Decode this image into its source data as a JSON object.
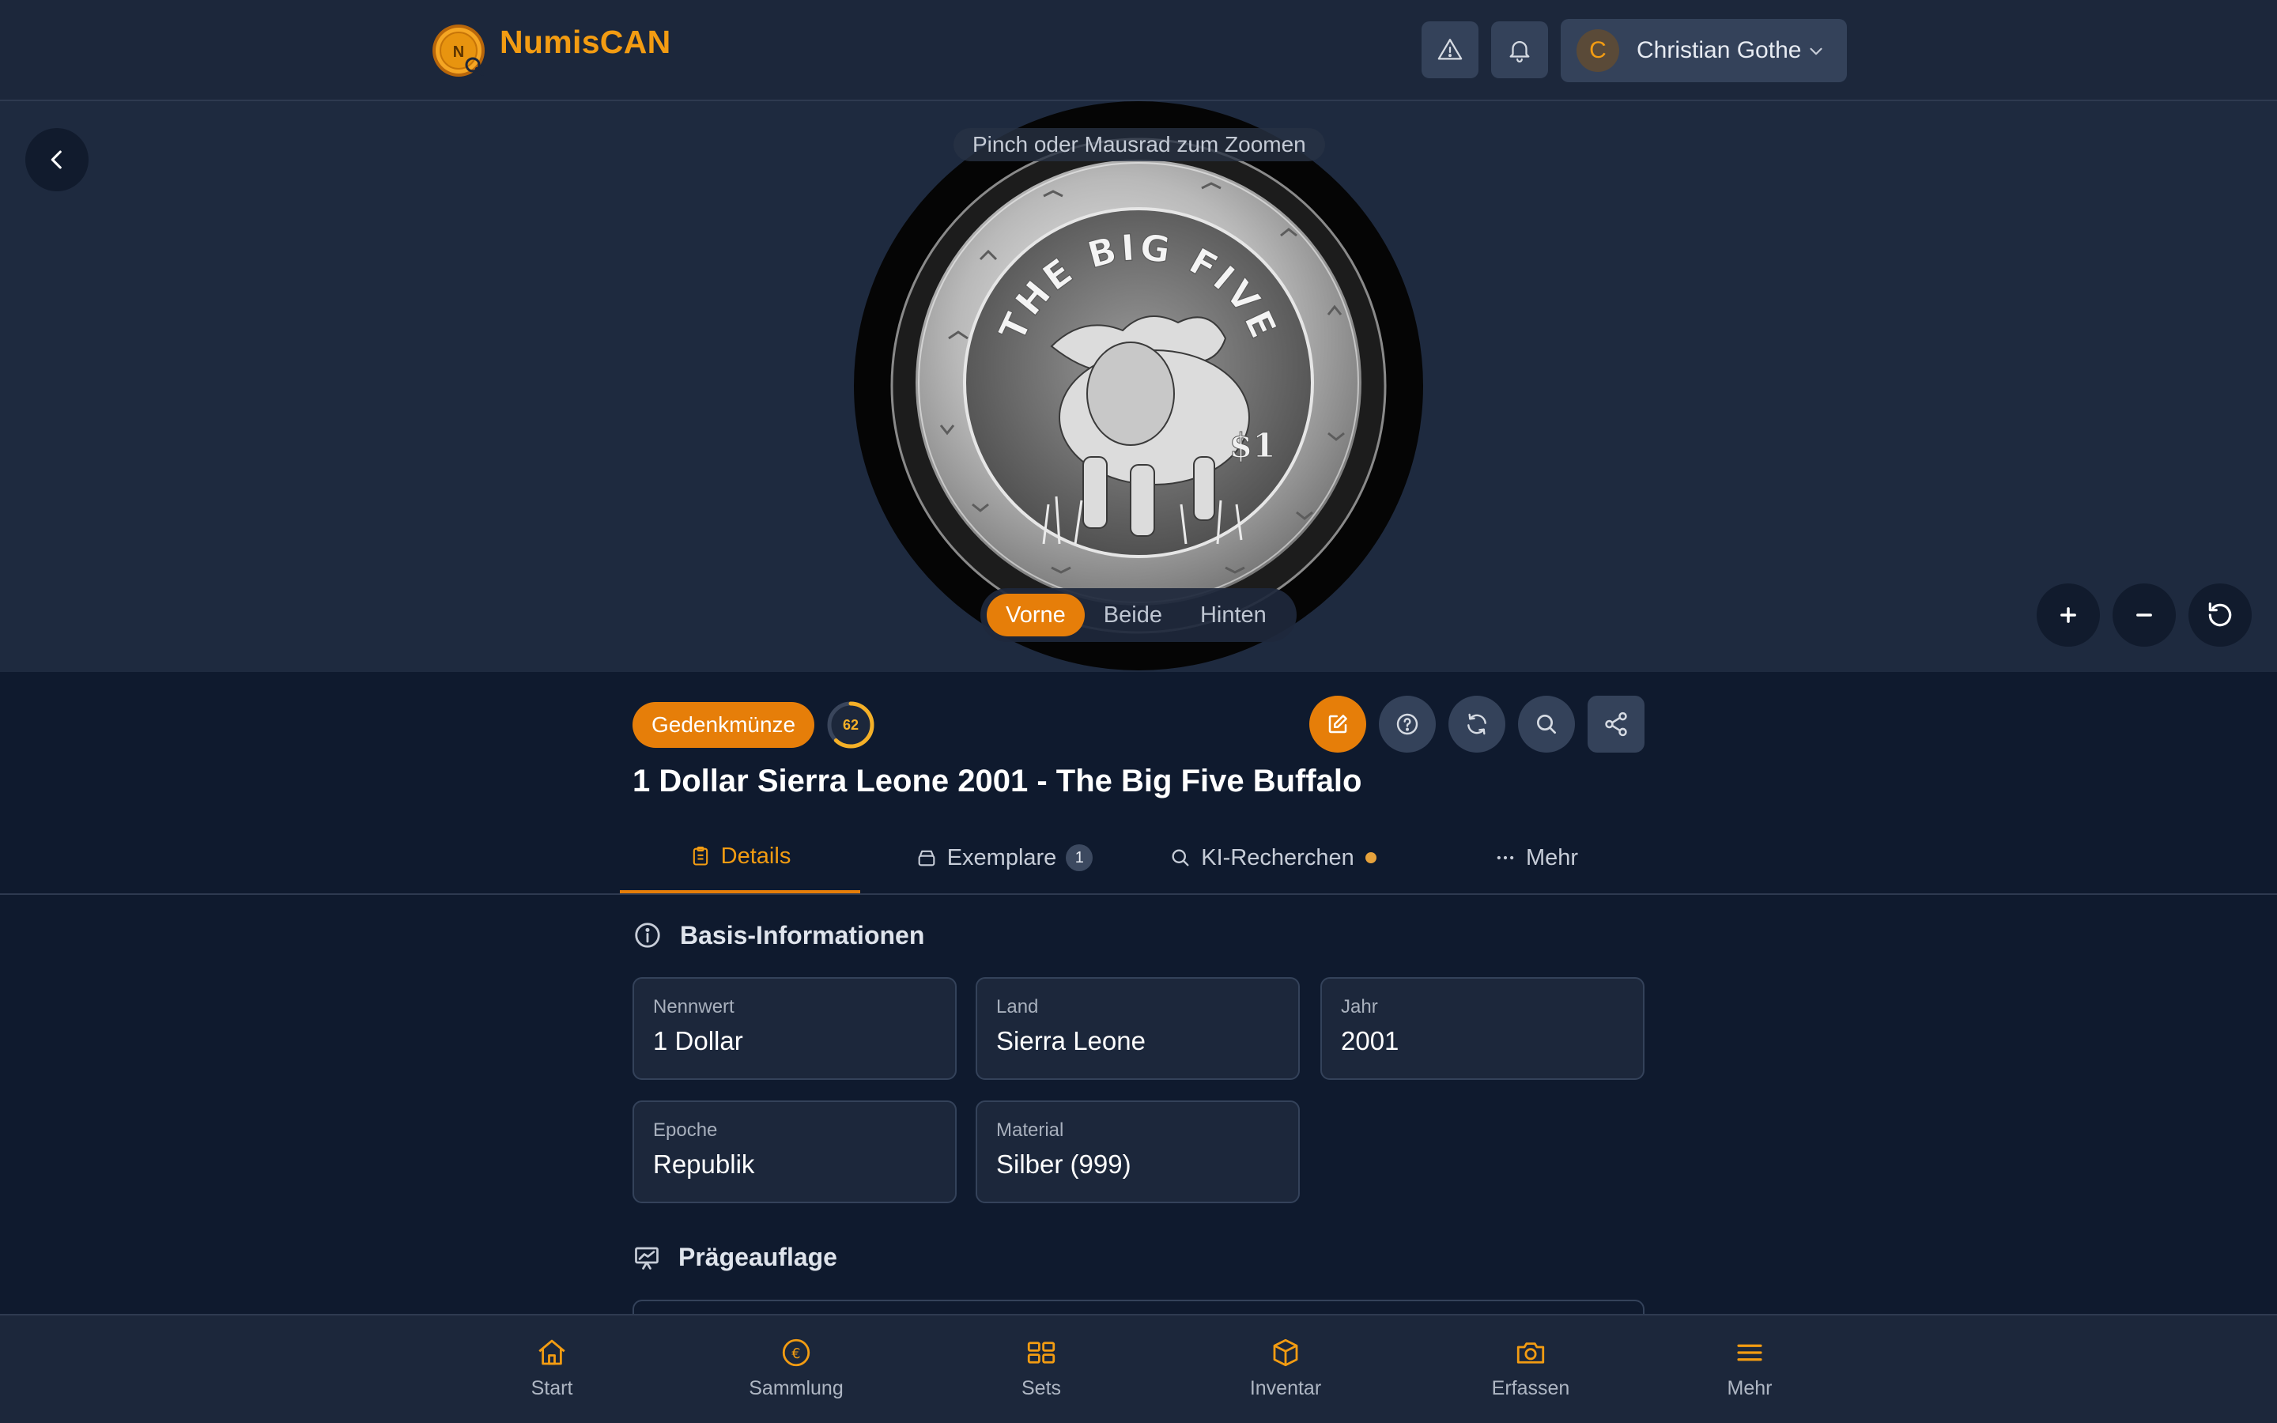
{
  "app": {
    "name": "NumisCAN"
  },
  "header": {
    "user_initial": "C",
    "user_name": "Christian Gothe"
  },
  "viewer": {
    "zoom_hint": "Pinch oder Mausrad zum Zoomen",
    "sides": [
      {
        "label": "Vorne",
        "active": true
      },
      {
        "label": "Beide",
        "active": false
      },
      {
        "label": "Hinten",
        "active": false
      }
    ],
    "coin_inscription": "THE BIG FIVE"
  },
  "coin": {
    "category_badge": "Gedenkmünze",
    "score": "62",
    "score_fraction": 0.62,
    "title": "1 Dollar Sierra Leone 2001 - The Big Five Buffalo"
  },
  "tabs": [
    {
      "label": "Details",
      "active": true
    },
    {
      "label": "Exemplare",
      "count": "1"
    },
    {
      "label": "KI-Recherchen",
      "dot": true
    },
    {
      "label": "Mehr"
    }
  ],
  "basis": {
    "heading": "Basis-Informationen",
    "fields": [
      {
        "label": "Nennwert",
        "value": "1 Dollar"
      },
      {
        "label": "Land",
        "value": "Sierra Leone"
      },
      {
        "label": "Jahr",
        "value": "2001"
      },
      {
        "label": "Epoche",
        "value": "Republik"
      },
      {
        "label": "Material",
        "value": "Silber (999)"
      }
    ]
  },
  "mintage": {
    "heading": "Prägeauflage"
  },
  "bottom_nav": [
    {
      "label": "Start",
      "icon": "home-icon"
    },
    {
      "label": "Sammlung",
      "icon": "euro-coin-icon"
    },
    {
      "label": "Sets",
      "icon": "grid-icon"
    },
    {
      "label": "Inventar",
      "icon": "box-icon"
    },
    {
      "label": "Erfassen",
      "icon": "camera-icon"
    },
    {
      "label": "Mehr",
      "icon": "menu-icon"
    }
  ],
  "colors": {
    "accent": "#e67e09",
    "brand": "#f39c12",
    "background": "#0f1a2e",
    "surface": "#1c273b"
  }
}
